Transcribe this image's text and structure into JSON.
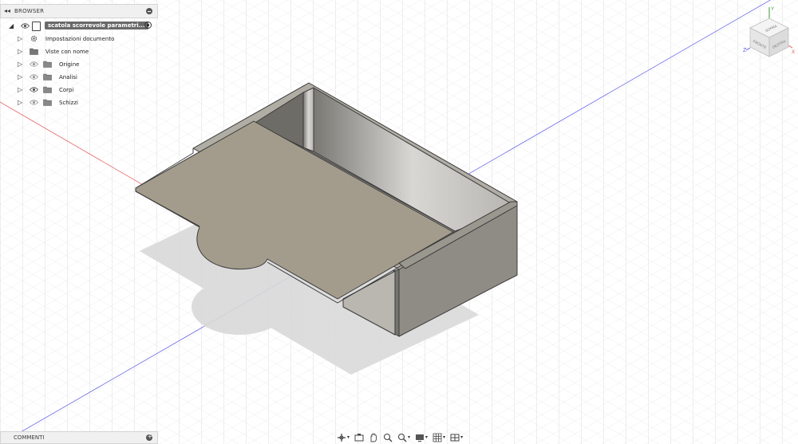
{
  "browser": {
    "title": "BROWSER",
    "root": {
      "label": "scatola scorrevole parametri..."
    },
    "items": [
      {
        "label": "Impostazioni documento",
        "icon": "gear-icon"
      },
      {
        "label": "Viste con nome",
        "icon": "folder-icon"
      },
      {
        "label": "Origine",
        "icon": "folder-icon"
      },
      {
        "label": "Analisi",
        "icon": "folder-icon"
      },
      {
        "label": "Corpi",
        "icon": "folder-icon"
      },
      {
        "label": "Schizzi",
        "icon": "folder-icon"
      }
    ]
  },
  "comments": {
    "title": "COMMENTI"
  },
  "viewcube": {
    "top": "SOPRA",
    "front": "FRONTE",
    "right": "DESTRA",
    "axis_z": "Z",
    "axis_y": "Y",
    "axis_x": "X"
  },
  "toolbar": {
    "icons": [
      "orbit-icon",
      "look-at-icon",
      "pan-icon",
      "zoom-window-icon",
      "zoom-icon",
      "display-mode-icon",
      "grid-icon",
      "viewports-icon"
    ]
  },
  "colors": {
    "background": "#ffffff",
    "grid": "#d6d6d6",
    "model": "#a39c8c",
    "x_axis": "#e05a5a",
    "y_axis": "#5a5ae0"
  }
}
